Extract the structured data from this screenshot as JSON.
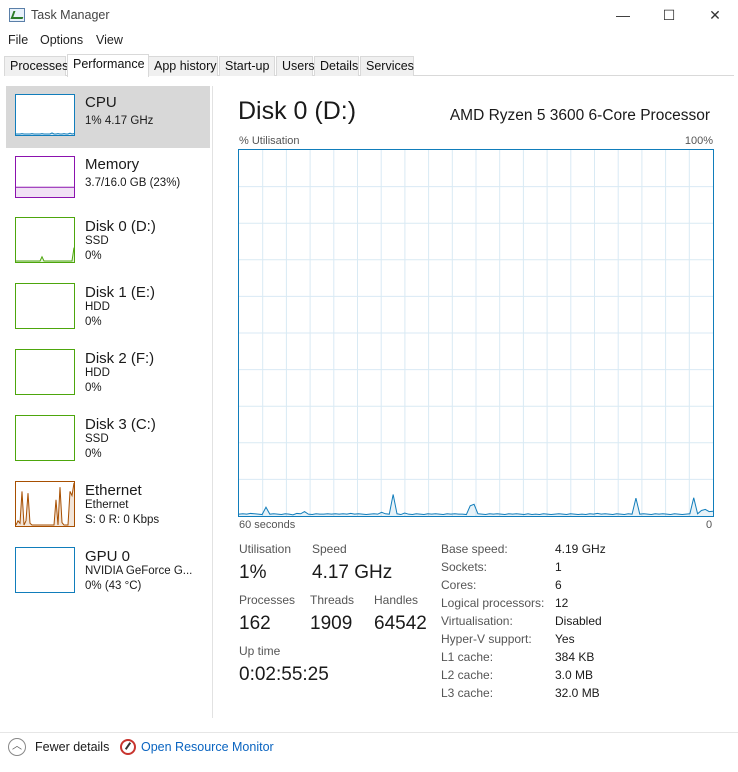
{
  "window": {
    "title": "Task Manager",
    "min_glyph": "—",
    "max_glyph": "☐",
    "close_glyph": "✕"
  },
  "menu": [
    "File",
    "Options",
    "View"
  ],
  "tabs": [
    "Processes",
    "Performance",
    "App history",
    "Start-up",
    "Users",
    "Details",
    "Services"
  ],
  "active_tab": "Performance",
  "sidebar": [
    {
      "title": "CPU",
      "line1": "1% 4.17 GHz",
      "line2": "",
      "color": "#117dbb",
      "selected": true,
      "graph": [
        0,
        0,
        0,
        1,
        0,
        0,
        0,
        0,
        1,
        0,
        0,
        0,
        0,
        1,
        0,
        0,
        0,
        0,
        3,
        0,
        0,
        1,
        0,
        0,
        1,
        0,
        0,
        2,
        0,
        1
      ]
    },
    {
      "title": "Memory",
      "line1": "3.7/16.0 GB (23%)",
      "line2": "",
      "color": "#8b12ae",
      "selected": false,
      "graph": [
        23,
        23,
        23,
        23,
        23,
        23,
        23,
        23,
        23,
        23,
        23,
        23,
        23,
        23,
        23,
        23,
        23,
        23,
        23,
        23,
        23,
        23,
        23,
        23,
        23,
        23,
        23,
        23,
        23,
        23
      ]
    },
    {
      "title": "Disk 0 (D:)",
      "line1": "SSD",
      "line2": "0%",
      "color": "#4da60c",
      "selected": false,
      "graph": [
        0,
        0,
        0,
        0,
        0,
        0,
        0,
        0,
        0,
        0,
        0,
        0,
        0,
        10,
        0,
        0,
        0,
        0,
        0,
        0,
        0,
        0,
        0,
        0,
        0,
        0,
        0,
        0,
        0,
        32
      ]
    },
    {
      "title": "Disk 1 (E:)",
      "line1": "HDD",
      "line2": "0%",
      "color": "#4da60c",
      "selected": false,
      "graph": []
    },
    {
      "title": "Disk 2 (F:)",
      "line1": "HDD",
      "line2": "0%",
      "color": "#4da60c",
      "selected": false,
      "graph": []
    },
    {
      "title": "Disk 3 (C:)",
      "line1": "SSD",
      "line2": "0%",
      "color": "#4da60c",
      "selected": false,
      "graph": []
    },
    {
      "title": "Ethernet",
      "line1": "Ethernet",
      "line2": "S: 0 R: 0 Kbps",
      "color": "#a74f01",
      "selected": false,
      "graph": [
        0,
        5,
        2,
        40,
        0,
        5,
        38,
        2,
        0,
        0,
        0,
        0,
        0,
        0,
        0,
        0,
        0,
        0,
        0,
        0,
        30,
        0,
        45,
        3,
        0,
        0,
        0,
        40,
        35,
        50
      ]
    },
    {
      "title": "GPU 0",
      "line1": "NVIDIA GeForce G...",
      "line2": "0% (43 °C)",
      "color": "#117dbb",
      "selected": false,
      "graph": []
    }
  ],
  "main": {
    "title": "Disk 0 (D:)",
    "processor": "AMD Ryzen 5 3600 6-Core Processor",
    "y_label": "% Utilisation",
    "y_max_label": "100%",
    "x_left_label": "60 seconds",
    "x_right_label": "0",
    "stats": {
      "utilisation_label": "Utilisation",
      "utilisation": "1%",
      "speed_label": "Speed",
      "speed": "4.17 GHz",
      "processes_label": "Processes",
      "processes": "162",
      "threads_label": "Threads",
      "threads": "1909",
      "handles_label": "Handles",
      "handles": "64542",
      "uptime_label": "Up time",
      "uptime": "0:02:55:25"
    },
    "details": [
      {
        "key": "Base speed:",
        "value": "4.19 GHz"
      },
      {
        "key": "Sockets:",
        "value": "1"
      },
      {
        "key": "Cores:",
        "value": "6"
      },
      {
        "key": "Logical processors:",
        "value": "12"
      },
      {
        "key": "Virtualisation:",
        "value": "Disabled"
      },
      {
        "key": "Hyper-V support:",
        "value": "Yes"
      },
      {
        "key": "L1 cache:",
        "value": "384 KB"
      },
      {
        "key": "L2 cache:",
        "value": "3.0 MB"
      },
      {
        "key": "L3 cache:",
        "value": "32.0 MB"
      }
    ]
  },
  "chart_data": {
    "type": "line",
    "ylabel": "% Utilisation",
    "ylim": [
      0,
      100
    ],
    "x_range_seconds": [
      60,
      0
    ],
    "grid": true,
    "series": [
      {
        "color": "#117dbb",
        "values": [
          0.5,
          0.6,
          0.5,
          0.7,
          0.6,
          0.5,
          0.4,
          2.4,
          0.5,
          0.6,
          0.5,
          0.4,
          0.6,
          0.5,
          0.3,
          0.7,
          0.6,
          1.2,
          0.5,
          0.4,
          0.6,
          0.5,
          0.5,
          0.6,
          0.5,
          0.6,
          0.5,
          0.6,
          0.5,
          0.7,
          0.5,
          0.6,
          0.5,
          0.4,
          0.5,
          0.6,
          0.5,
          1.0,
          0.6,
          0.5,
          5.9,
          0.6,
          0.4,
          0.8,
          0.5,
          0.4,
          0.6,
          0.5,
          0.4,
          0.6,
          0.5,
          0.6,
          0.5,
          0.4,
          0.6,
          0.5,
          0.6,
          0.5,
          0.5,
          0.4,
          2.8,
          3.2,
          0.6,
          0.5,
          0.4,
          0.6,
          0.5,
          0.6,
          0.5,
          0.4,
          0.6,
          0.5,
          0.6,
          0.5,
          0.4,
          0.6,
          0.4,
          0.5,
          0.4,
          0.6,
          0.5,
          0.4,
          0.5,
          0.6,
          0.5,
          0.4,
          0.6,
          0.5,
          0.4,
          0.5,
          0.4,
          0.6,
          0.5,
          0.7,
          0.5,
          0.6,
          0.5,
          0.4,
          0.6,
          0.5,
          0.4,
          0.6,
          0.5,
          4.9,
          0.5,
          0.6,
          0.5,
          0.4,
          0.6,
          0.5,
          0.6,
          0.5,
          0.4,
          0.6,
          0.5,
          0.4,
          0.5,
          0.6,
          5.0,
          0.6,
          1.5,
          1.8,
          1.2,
          1.3
        ]
      }
    ]
  },
  "footer": {
    "fewer_details": "Fewer details",
    "open_resource_monitor": "Open Resource Monitor"
  }
}
